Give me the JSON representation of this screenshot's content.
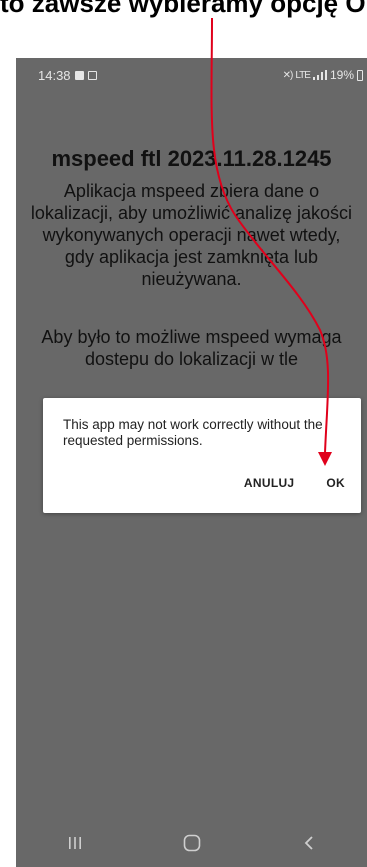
{
  "caption": {
    "text": "to zawsze wybieramy opcję OK"
  },
  "status_bar": {
    "time": "14:38",
    "network": "LTE",
    "battery": "19%"
  },
  "app": {
    "title": "mspeed ftl 2023.11.28.1245",
    "paragraph1": "Aplikacja mspeed zbiera dane o lokalizacji, aby umożliwić analizę jakości wykonywanych operacji nawet wtedy, gdy aplikacja jest zamknięta lub nieużywana.",
    "paragraph2": "Aby było to możliwe mspeed wymaga dostepu do lokalizacji w tle"
  },
  "dialog": {
    "message": "This app may not work correctly without the requested permissions.",
    "cancel_label": "ANULUJ",
    "ok_label": "OK"
  },
  "nav_bar": {
    "icons": [
      "recents-icon",
      "home-icon",
      "back-icon"
    ]
  },
  "colors": {
    "screen_dim": "#686868",
    "annotation_arrow": "#e0001b",
    "dialog_bg": "#ffffff"
  }
}
